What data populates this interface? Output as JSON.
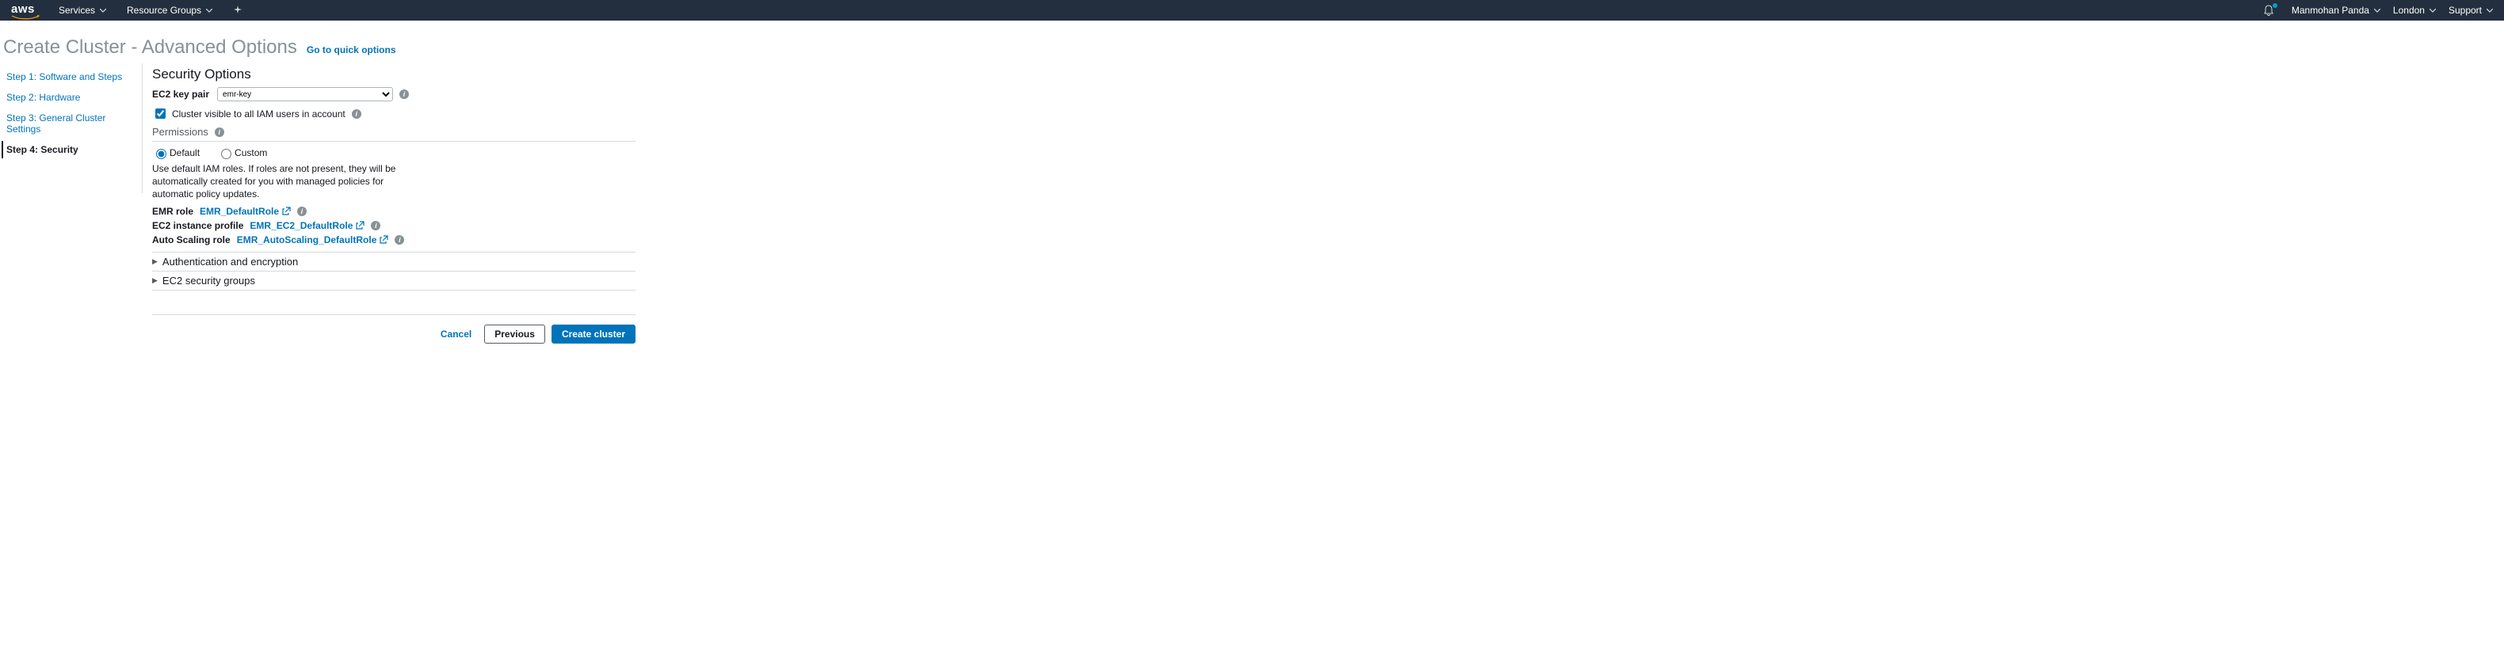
{
  "topnav": {
    "logo": "aws",
    "services": "Services",
    "resource_groups": "Resource Groups",
    "user": "Manmohan Panda",
    "region": "London",
    "support": "Support"
  },
  "header": {
    "title": "Create Cluster - Advanced Options",
    "quick": "Go to quick options"
  },
  "steps": [
    "Step 1: Software and Steps",
    "Step 2: Hardware",
    "Step 3: General Cluster Settings",
    "Step 4: Security"
  ],
  "active_step_index": 3,
  "security": {
    "heading": "Security Options",
    "ec2_keypair_label": "EC2 key pair",
    "ec2_keypair_value": "emr-key",
    "visible_label": "Cluster visible to all IAM users in account",
    "visible_checked": true
  },
  "permissions": {
    "heading": "Permissions",
    "default_label": "Default",
    "custom_label": "Custom",
    "selected": "default",
    "desc": "Use default IAM roles. If roles are not present, they will be automatically created for you with managed policies for automatic policy updates.",
    "roles": [
      {
        "label": "EMR role",
        "link": "EMR_DefaultRole"
      },
      {
        "label": "EC2 instance profile",
        "link": "EMR_EC2_DefaultRole"
      },
      {
        "label": "Auto Scaling role",
        "link": "EMR_AutoScaling_DefaultRole"
      }
    ]
  },
  "expanders": [
    "Authentication and encryption",
    "EC2 security groups"
  ],
  "buttons": {
    "cancel": "Cancel",
    "previous": "Previous",
    "create": "Create cluster"
  }
}
